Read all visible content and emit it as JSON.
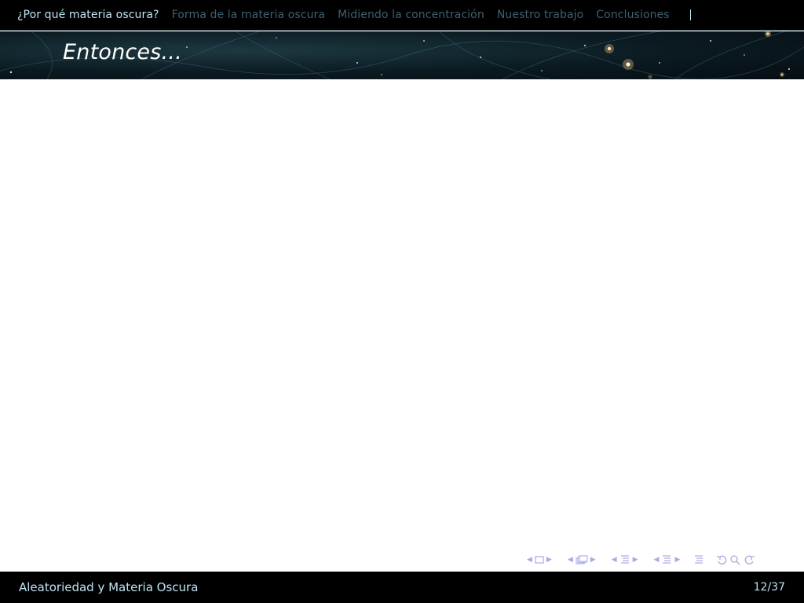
{
  "topnav": {
    "sections": [
      {
        "label": "¿Por qué materia oscura?",
        "active": true
      },
      {
        "label": "Forma de la materia oscura",
        "active": false
      },
      {
        "label": "Midiendo la concentración",
        "active": false
      },
      {
        "label": "Nuestro trabajo",
        "active": false
      },
      {
        "label": "Conclusiones",
        "active": false
      }
    ]
  },
  "frame": {
    "title": "Entonces..."
  },
  "navsymbols": {
    "icons": [
      "slide-nav-icon",
      "frame-nav-icon",
      "subsection-nav-icon",
      "section-nav-icon",
      "document-nav-icon",
      "back-forward-search-icon"
    ]
  },
  "footer": {
    "title": "Aleatoriedad y Materia Oscura",
    "page": "12/37"
  },
  "colors": {
    "bar_background": "#000000",
    "active_section": "#bfe4f4",
    "inactive_section": "#3f5f6e",
    "title_text": "#ffffff",
    "nav_symbols": "#a9a9e6"
  }
}
